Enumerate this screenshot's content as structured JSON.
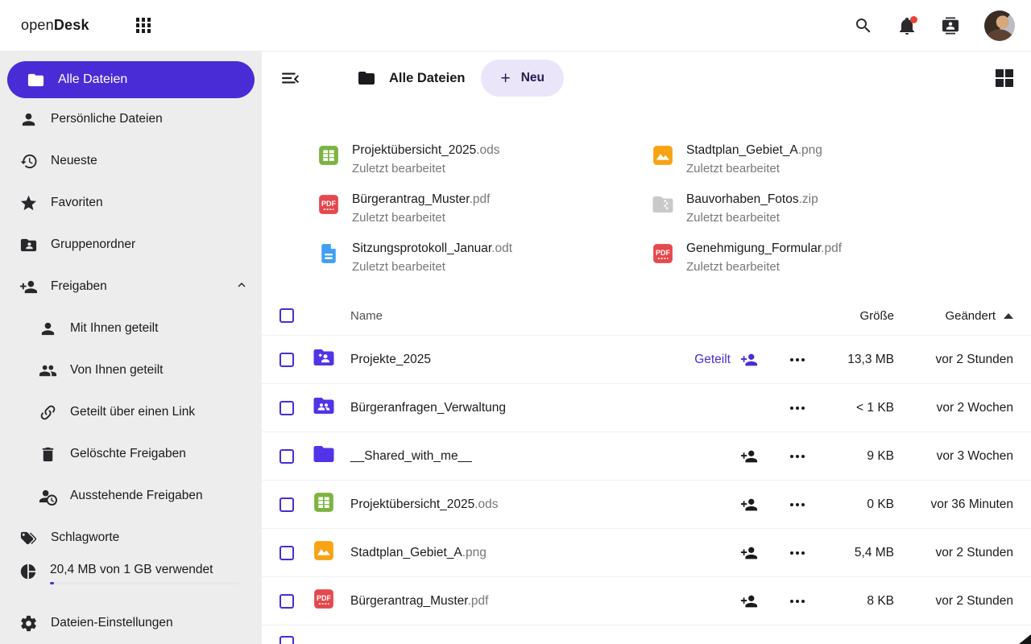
{
  "colors": {
    "accent": "#4a2cd6",
    "folder": "#5233e8",
    "new_button_bg": "#ebe5fa",
    "new_button_text": "#25204f",
    "pdf_red": "#e5484d",
    "ods_green": "#7db441",
    "png_amber": "#f7a313",
    "zip_gray": "#c9c9ca",
    "odt_blue": "#3f9ff4",
    "notification_red": "#ea4236",
    "sidebar_bg": "#ededee"
  },
  "topbar": {
    "logo_regular": "open",
    "logo_bold": "Desk",
    "icons": [
      "apps-grid",
      "search",
      "notifications",
      "contacts",
      "avatar"
    ]
  },
  "sidebar": {
    "items": [
      {
        "label": "Alle Dateien",
        "icon": "folder",
        "active": true
      },
      {
        "label": "Persönliche Dateien",
        "icon": "person"
      },
      {
        "label": "Neueste",
        "icon": "history"
      },
      {
        "label": "Favoriten",
        "icon": "star"
      },
      {
        "label": "Gruppenordner",
        "icon": "folder-account"
      },
      {
        "label": "Freigaben",
        "icon": "person-plus",
        "expanded": true
      },
      {
        "label": "Mit Ihnen geteilt",
        "icon": "person",
        "sub": true
      },
      {
        "label": "Von Ihnen geteilt",
        "icon": "people-group",
        "sub": true
      },
      {
        "label": "Geteilt über einen Link",
        "icon": "link",
        "sub": true
      },
      {
        "label": "Gelöschte Freigaben",
        "icon": "trash",
        "sub": true
      },
      {
        "label": "Ausstehende Freigaben",
        "icon": "person-clock",
        "sub": true
      },
      {
        "label": "Schlagworte",
        "icon": "tags"
      }
    ],
    "storage": {
      "label": "20,4 MB von 1 GB verwendet",
      "icon": "pie-chart",
      "percent": 2
    },
    "settings": {
      "label": "Dateien-Einstellungen",
      "icon": "gear"
    }
  },
  "header": {
    "title": "Alle Dateien",
    "new_plus": "+",
    "new_label": "Neu"
  },
  "recent": [
    {
      "name": "Projektübersicht_2025",
      "ext": ".ods",
      "subtitle": "Zuletzt bearbeitet",
      "type": "ods"
    },
    {
      "name": "Stadtplan_Gebiet_A",
      "ext": ".png",
      "subtitle": "Zuletzt bearbeitet",
      "type": "image"
    },
    {
      "name": "Bürgerantrag_Muster",
      "ext": ".pdf",
      "subtitle": "Zuletzt bearbeitet",
      "type": "pdf"
    },
    {
      "name": "Bauvorhaben_Fotos",
      "ext": ".zip",
      "subtitle": "Zuletzt bearbeitet",
      "type": "zip"
    },
    {
      "name": "Sitzungsprotokoll_Januar",
      "ext": ".odt",
      "subtitle": "Zuletzt bearbeitet",
      "type": "odt"
    },
    {
      "name": "Genehmigung_Formular",
      "ext": ".pdf",
      "subtitle": "Zuletzt bearbeitet",
      "type": "pdf"
    }
  ],
  "table": {
    "columns": {
      "name": "Name",
      "size": "Größe",
      "modified": "Geändert"
    },
    "sort": "ascending",
    "rows": [
      {
        "name": "Projekte_2025",
        "ext": "",
        "type": "folder-shared",
        "shared_label": "Geteilt",
        "size": "13,3 MB",
        "modified": "vor 2 Stunden"
      },
      {
        "name": "Bürgeranfragen_Verwaltung",
        "ext": "",
        "type": "folder-group",
        "size": "< 1 KB",
        "modified": "vor 2 Wochen"
      },
      {
        "name": "__Shared_with_me__",
        "ext": "",
        "type": "folder",
        "size": "9 KB",
        "modified": "vor 3 Wochen"
      },
      {
        "name": "Projektübersicht_2025",
        "ext": ".ods",
        "type": "ods",
        "size": "0 KB",
        "modified": "vor 36 Minuten"
      },
      {
        "name": "Stadtplan_Gebiet_A",
        "ext": ".png",
        "type": "image",
        "size": "5,4 MB",
        "modified": "vor 2 Stunden"
      },
      {
        "name": "Bürgerantrag_Muster",
        "ext": ".pdf",
        "type": "pdf",
        "size": "8 KB",
        "modified": "vor 2 Stunden"
      }
    ]
  }
}
